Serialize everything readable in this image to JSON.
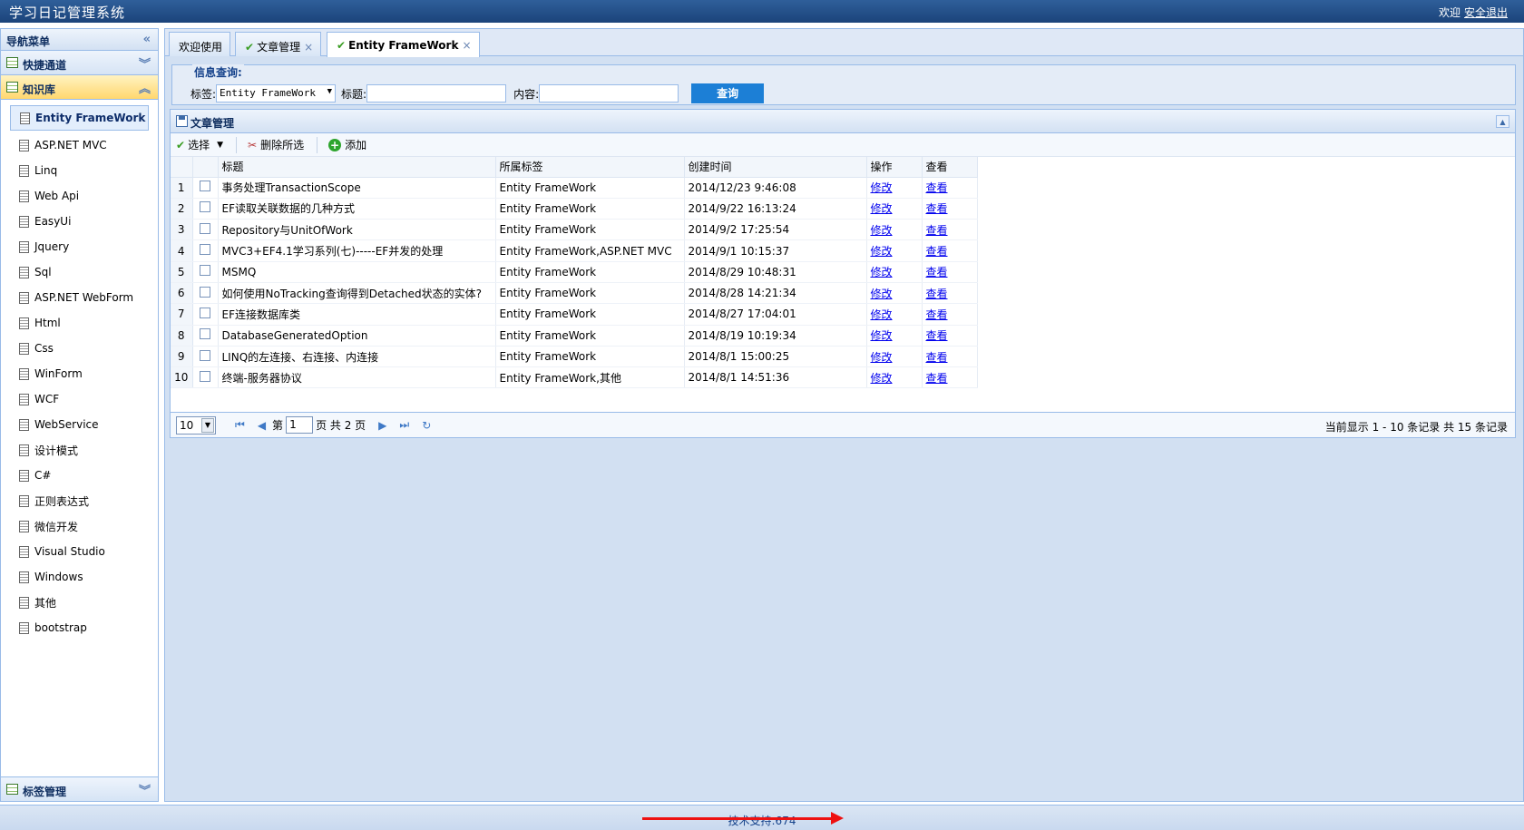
{
  "app": {
    "title": "学习日记管理系统",
    "welcome": "欢迎",
    "logout": "安全退出"
  },
  "nav": {
    "title": "导航菜单",
    "sections": {
      "quick": "快捷通道",
      "kb": "知识库",
      "tags": "标签管理"
    },
    "items": [
      "Entity FrameWork",
      "ASP.NET MVC",
      "Linq",
      "Web Api",
      "EasyUi",
      "Jquery",
      "Sql",
      "ASP.NET WebForm",
      "Html",
      "Css",
      "WinForm",
      "WCF",
      "WebService",
      "设计模式",
      "C#",
      "正则表达式",
      "微信开发",
      "Visual Studio",
      "Windows",
      "其他",
      "bootstrap"
    ],
    "selected": "Entity FrameWork"
  },
  "tabs": [
    "欢迎使用",
    "文章管理",
    "Entity FrameWork"
  ],
  "search": {
    "legend": "信息查询:",
    "tag_label": "标签:",
    "tag_value": "Entity FrameWork",
    "title_label": "标题:",
    "content_label": "内容:",
    "query_button": "查询"
  },
  "grid": {
    "title": "文章管理",
    "toolbar": {
      "select": "选择",
      "delete": "删除所选",
      "add": "添加"
    },
    "columns": [
      "标题",
      "所属标签",
      "创建时间",
      "操作",
      "查看"
    ],
    "rows": [
      {
        "n": "1",
        "title": "事务处理TransactionScope",
        "tag": "Entity FrameWork",
        "time": "2014/12/23 9:46:08",
        "edit": "修改",
        "view": "查看"
      },
      {
        "n": "2",
        "title": "EF读取关联数据的几种方式",
        "tag": "Entity FrameWork",
        "time": "2014/9/22 16:13:24",
        "edit": "修改",
        "view": "查看"
      },
      {
        "n": "3",
        "title": "Repository与UnitOfWork",
        "tag": "Entity FrameWork",
        "time": "2014/9/2 17:25:54",
        "edit": "修改",
        "view": "查看"
      },
      {
        "n": "4",
        "title": "MVC3+EF4.1学习系列(七)-----EF并发的处理",
        "tag": "Entity FrameWork,ASP.NET MVC",
        "time": "2014/9/1 10:15:37",
        "edit": "修改",
        "view": "查看"
      },
      {
        "n": "5",
        "title": "MSMQ",
        "tag": "Entity FrameWork",
        "time": "2014/8/29 10:48:31",
        "edit": "修改",
        "view": "查看"
      },
      {
        "n": "6",
        "title": "如何使用NoTracking查询得到Detached状态的实体?",
        "tag": "Entity FrameWork",
        "time": "2014/8/28 14:21:34",
        "edit": "修改",
        "view": "查看"
      },
      {
        "n": "7",
        "title": "EF连接数据库类",
        "tag": "Entity FrameWork",
        "time": "2014/8/27 17:04:01",
        "edit": "修改",
        "view": "查看"
      },
      {
        "n": "8",
        "title": "DatabaseGeneratedOption",
        "tag": "Entity FrameWork",
        "time": "2014/8/19 10:19:34",
        "edit": "修改",
        "view": "查看"
      },
      {
        "n": "9",
        "title": "LINQ的左连接、右连接、内连接",
        "tag": "Entity FrameWork",
        "time": "2014/8/1 15:00:25",
        "edit": "修改",
        "view": "查看"
      },
      {
        "n": "10",
        "title": "终端-服务器协议",
        "tag": "Entity FrameWork,其他",
        "time": "2014/8/1 14:51:36",
        "edit": "修改",
        "view": "查看"
      }
    ]
  },
  "pager": {
    "page_size": "10",
    "page_prefix": "第",
    "page": "1",
    "page_suffix": "页 共 2 页",
    "info": "当前显示 1 - 10 条记录 共 15 条记录"
  },
  "footer": {
    "text": "技术支持:674"
  }
}
